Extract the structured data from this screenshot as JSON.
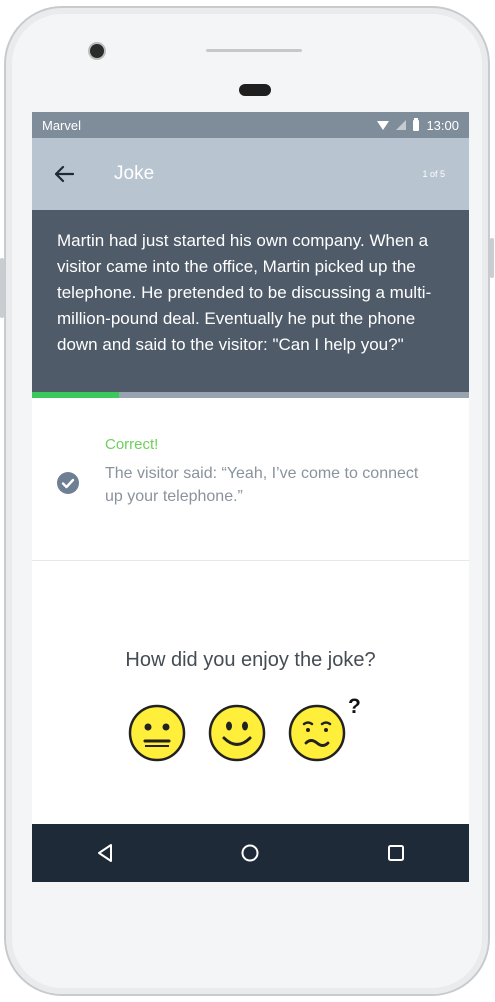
{
  "status_bar": {
    "carrier": "Marvel",
    "time": "13:00"
  },
  "app_bar": {
    "title": "Joke",
    "counter": "1 of 5"
  },
  "joke": {
    "text": "Martin had just started his own company. When a visitor came into the office, Martin picked up the telephone. He pretended to be discussing a multi-million-pound deal. Eventually he put the phone down and said to the visitor: \"Can I help you?\""
  },
  "progress": {
    "fraction": 0.2,
    "fill_color": "#3cc95c"
  },
  "answer": {
    "status_label": "Correct!",
    "text": "The visitor said: “Yeah, I’ve come to connect up your telephone.”",
    "icon": "check-circle-icon"
  },
  "rating": {
    "question": "How did you enjoy the joke?",
    "options": [
      {
        "name": "neutral-face-icon"
      },
      {
        "name": "smiling-face-icon"
      },
      {
        "name": "confused-face-icon"
      }
    ],
    "extra_symbol": "?"
  },
  "nav": {
    "icons": [
      "back-triangle-icon",
      "home-circle-icon",
      "recents-square-icon"
    ]
  },
  "colors": {
    "status_bar": "#7f8d9a",
    "app_bar": "#b8c4cf",
    "joke_panel": "#4f5b69",
    "nav_bar": "#1f2a38",
    "emoji_fill": "#ffee3a"
  }
}
